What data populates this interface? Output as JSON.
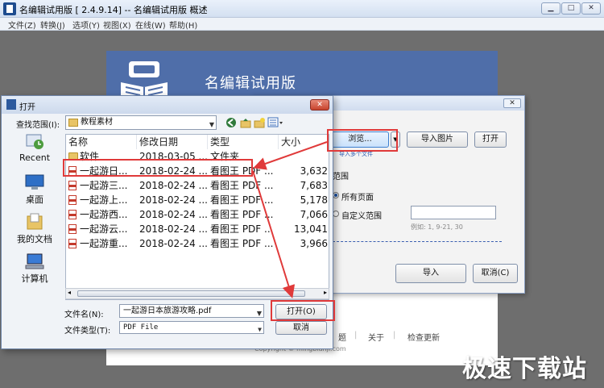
{
  "app": {
    "title": "名编辑试用版 [ 2.4.9.14] -- 名编辑试用版 概述",
    "menu": [
      "文件(Z)",
      "转换(J)",
      "选项(Y)",
      "视图(X)",
      "在线(W)",
      "帮助(H)"
    ],
    "banner_title": "名编辑试用版",
    "footer_links": [
      "题",
      "关于",
      "检查更新"
    ],
    "footer_copy": "Copyright © mingbianji.com"
  },
  "convert_dialog": {
    "browse_label": "浏览...",
    "browse_hint": "导入多个文件",
    "import_image_label": "导入图片",
    "open_label": "打开",
    "range_title": "范围",
    "all_pages_label": "所有页面",
    "custom_range_label": "自定义范围",
    "range_example": "例如: 1, 9-21, 30",
    "import_button": "导入",
    "cancel_button": "取消(C)"
  },
  "open_dialog": {
    "title": "打开",
    "lookin_label": "查找范围(I):",
    "lookin_value": "教程素材",
    "places": [
      "Recent",
      "桌面",
      "我的文档",
      "计算机"
    ],
    "columns": [
      "名称",
      "修改日期",
      "类型",
      "大小"
    ],
    "files": [
      {
        "name": "软件",
        "date": "2018-03-05 ...",
        "type": "文件夹",
        "size": ""
      },
      {
        "name": "一起游日...",
        "date": "2018-02-24 ...",
        "type": "看图王 PDF ...",
        "size": "3,632"
      },
      {
        "name": "一起游三...",
        "date": "2018-02-24 ...",
        "type": "看图王 PDF ...",
        "size": "7,683"
      },
      {
        "name": "一起游上...",
        "date": "2018-02-24 ...",
        "type": "看图王 PDF ...",
        "size": "5,178"
      },
      {
        "name": "一起游西...",
        "date": "2018-02-24 ...",
        "type": "看图王 PDF ...",
        "size": "7,066"
      },
      {
        "name": "一起游云...",
        "date": "2018-02-24 ...",
        "type": "看图王 PDF ...",
        "size": "13,041"
      },
      {
        "name": "一起游重...",
        "date": "2018-02-24 ...",
        "type": "看图王 PDF ...",
        "size": "3,966"
      }
    ],
    "filename_label": "文件名(N):",
    "filename_value": "一起游日本旅游攻略.pdf",
    "filetype_label": "文件类型(T):",
    "filetype_value": "PDF File",
    "open_button": "打开(O)",
    "cancel_button": "取消"
  },
  "watermark": "极速下载站",
  "colors": {
    "highlight": "#e03a3a",
    "banner": "#4f6ea9"
  }
}
